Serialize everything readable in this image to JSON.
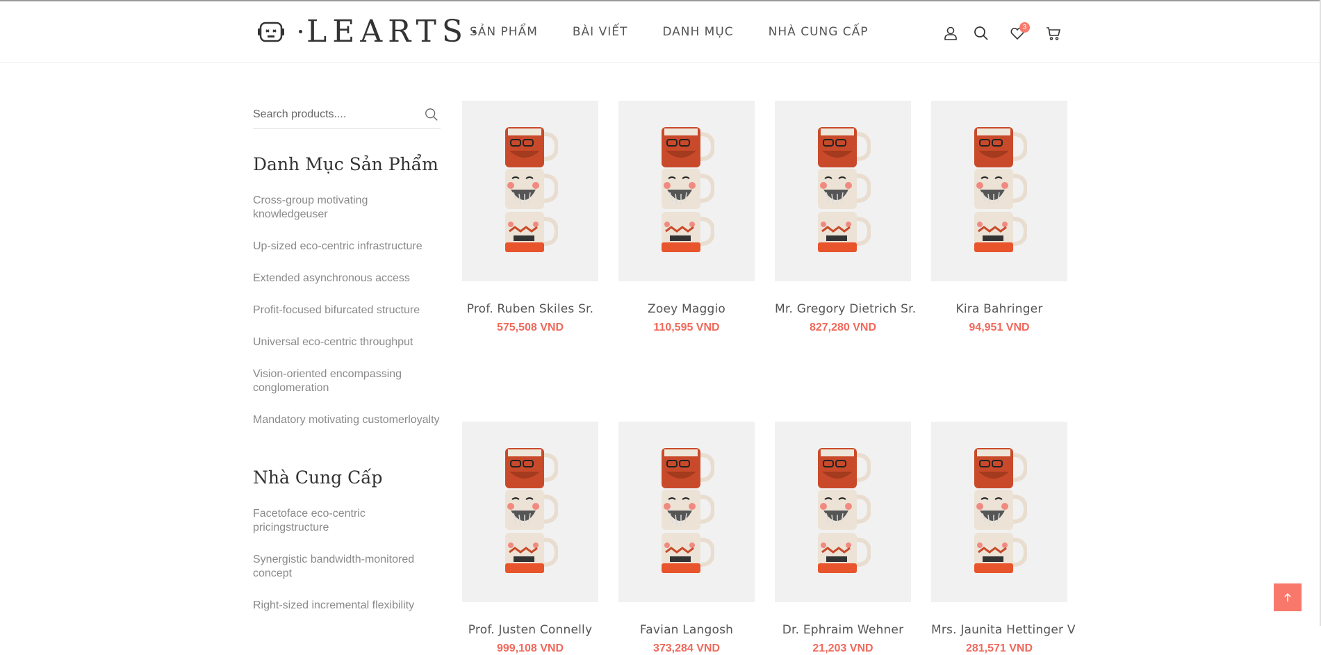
{
  "header": {
    "logo_text": "LEARTS",
    "nav": [
      "SẢN PHẨM",
      "BÀI VIẾT",
      "DANH MỤC",
      "NHÀ CUNG CẤP"
    ],
    "icons": [
      "user-icon",
      "search-icon",
      "heart-icon",
      "cart-icon"
    ],
    "wishlist_count": "3"
  },
  "sidebar": {
    "search_placeholder": "Search products....",
    "categories_title": "Danh Mục Sản Phẩm",
    "categories": [
      "Cross-group motivating knowledgeuser",
      "Up-sized eco-centric infrastructure",
      "Extended asynchronous access",
      "Profit-focused bifurcated structure",
      "Universal eco-centric throughput",
      "Vision-oriented encompassing conglomeration",
      "Mandatory motivating customerloyalty"
    ],
    "suppliers_title": "Nhà Cung Cấp",
    "suppliers": [
      "Facetoface eco-centric pricingstructure",
      "Synergistic bandwidth-monitored concept",
      "Right-sized incremental flexibility"
    ]
  },
  "products": [
    {
      "name": "Prof. Ruben Skiles Sr.",
      "price": "575,508 VND"
    },
    {
      "name": "Zoey Maggio",
      "price": "110,595 VND"
    },
    {
      "name": "Mr. Gregory Dietrich Sr.",
      "price": "827,280 VND"
    },
    {
      "name": "Kira Bahringer",
      "price": "94,951 VND"
    },
    {
      "name": "Prof. Justen Connelly",
      "price": "999,108 VND"
    },
    {
      "name": "Favian Langosh",
      "price": "373,284 VND"
    },
    {
      "name": "Dr. Ephraim Wehner",
      "price": "21,203 VND"
    },
    {
      "name": "Mrs. Jaunita Hettinger V",
      "price": "281,571 VND"
    }
  ],
  "back_to_top_icon": "arrow-up-icon",
  "colors": {
    "accent": "#f8796c",
    "price": "#f0695b",
    "thumb_bg": "#f1f1f1"
  }
}
